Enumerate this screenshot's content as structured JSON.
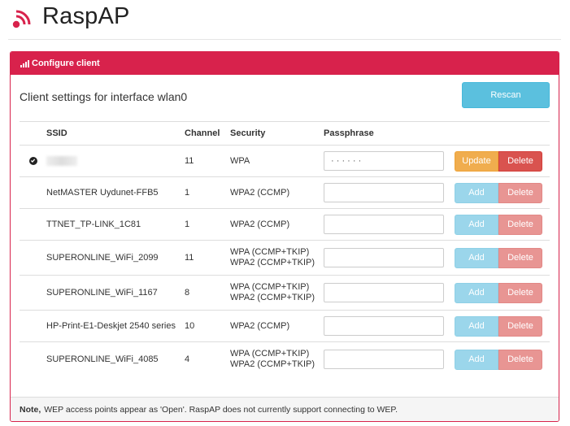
{
  "app": {
    "title": "RaspAP"
  },
  "panel": {
    "title": "Configure client",
    "subtitle": "Client settings for interface wlan0",
    "rescan_label": "Rescan"
  },
  "table": {
    "headers": {
      "ssid": "SSID",
      "channel": "Channel",
      "security": "Security",
      "passphrase": "Passphrase"
    },
    "rows": [
      {
        "ssid": "",
        "connected": true,
        "channel": "11",
        "security": [
          "WPA"
        ],
        "passphrase": "· · · · · ·",
        "primary": "Update",
        "secondary": "Delete"
      },
      {
        "ssid": "NetMASTER Uydunet-FFB5",
        "connected": false,
        "channel": "1",
        "security": [
          "WPA2 (CCMP)"
        ],
        "passphrase": "",
        "primary": "Add",
        "secondary": "Delete"
      },
      {
        "ssid": "TTNET_TP-LINK_1C81",
        "connected": false,
        "channel": "1",
        "security": [
          "WPA2 (CCMP)"
        ],
        "passphrase": "",
        "primary": "Add",
        "secondary": "Delete"
      },
      {
        "ssid": "SUPERONLINE_WiFi_2099",
        "connected": false,
        "channel": "11",
        "security": [
          "WPA (CCMP+TKIP)",
          "WPA2 (CCMP+TKIP)"
        ],
        "passphrase": "",
        "primary": "Add",
        "secondary": "Delete"
      },
      {
        "ssid": "SUPERONLINE_WiFi_1167",
        "connected": false,
        "channel": "8",
        "security": [
          "WPA (CCMP+TKIP)",
          "WPA2 (CCMP+TKIP)"
        ],
        "passphrase": "",
        "primary": "Add",
        "secondary": "Delete"
      },
      {
        "ssid": "HP-Print-E1-Deskjet 2540 series",
        "connected": false,
        "channel": "10",
        "security": [
          "WPA2 (CCMP)"
        ],
        "passphrase": "",
        "primary": "Add",
        "secondary": "Delete"
      },
      {
        "ssid": "SUPERONLINE_WiFi_4085",
        "connected": false,
        "channel": "4",
        "security": [
          "WPA (CCMP+TKIP)",
          "WPA2 (CCMP+TKIP)"
        ],
        "passphrase": "",
        "primary": "Add",
        "secondary": "Delete"
      }
    ]
  },
  "footer": {
    "note_label": "Note,",
    "note_text": "WEP access points appear as 'Open'. RaspAP does not currently support connecting to WEP."
  },
  "colors": {
    "brand": "#d8224c",
    "info": "#5bc0de",
    "warning": "#f0ad4e",
    "danger": "#d9534f"
  }
}
